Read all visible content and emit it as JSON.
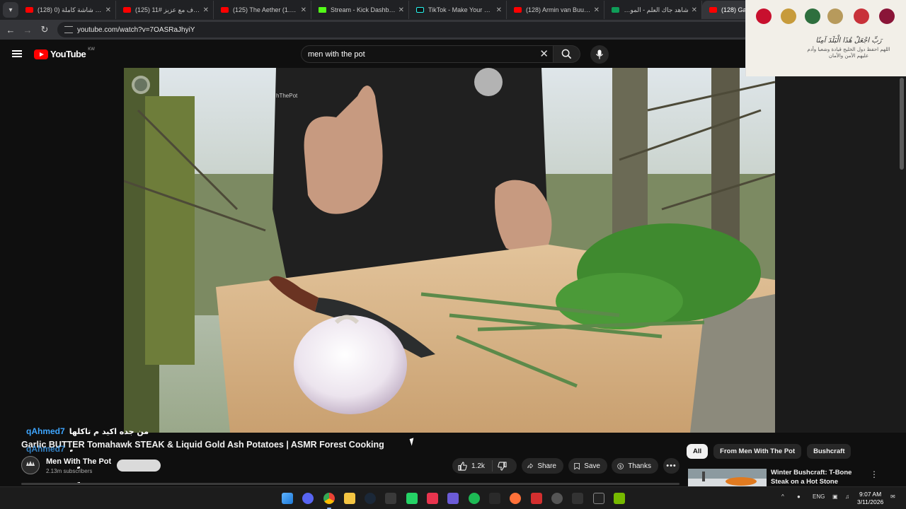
{
  "browser": {
    "tabs": [
      {
        "title": "(128) البث شاشة كاملة (0",
        "favicon": "youtube"
      },
      {
        "title": "(125) حروف مع عزيز #11",
        "favicon": "youtube"
      },
      {
        "title": "(125) The Aether (1.20.1) |",
        "favicon": "youtube"
      },
      {
        "title": "Stream - Kick Dashboard",
        "favicon": "kick"
      },
      {
        "title": "TikTok - Make Your Day",
        "favicon": "tiktok"
      },
      {
        "title": "(128) Armin van Buuren -",
        "favicon": "youtube"
      },
      {
        "title": "شاهد جاك العلم - الموسم",
        "favicon": "sheets"
      },
      {
        "title": "(128) Garli",
        "favicon": "youtube",
        "active": true
      }
    ],
    "url": "youtube.com/watch?v=7OASRaJhyiY"
  },
  "youtube": {
    "logo_text": "YouTube",
    "country_code": "KW",
    "search_query": "men with the pot"
  },
  "overlay": {
    "caption_line1": "رَبِّ اجْعَلْ هَٰذَا الْبَلَدَ آمِنًا",
    "caption_line2": "اللهم احفظ دول الخليج قيادة وشعبا وأدم عليهم الأمن والأمان"
  },
  "chat": {
    "message1": {
      "user": "qAhmed7",
      "text": "من جده اكيد م تاكلها"
    },
    "message2": {
      "user": "qAhmed7",
      "text": "ٍٍٍٍٍٍٍٍٍٍٍٍٍٍٍٍٍٍٍٍٍٍٍٍٍٍٍٍٍٍٍٍٍٍٍٍٍٍٍٍٍ"
    },
    "spam_line2": "ٍٍٍٍٍٍٍٍٍٍٍٍٍٍٍٍٍٍٍٍٍٍٍٍٍٍٍٍٍٍٍٍٍٍٍٍٍٍٍٍ",
    "spam_line3": "ٍٍٍٍٍٍٍٍٍٍٍٍٍٍٍٍٍٍٍٍٍٍٍٍٍٍٍٍٍٍٍٍٍٍٍٍٍٍٍٍ",
    "spam_line4": "ٍٍٍٍٍٍٍٍٍٍٍٍٍٍٍٍٍٍٍٍٍ"
  },
  "video": {
    "title": "Garlic BUTTER Tomahawk STEAK & Liquid Gold Ash Potatoes | ASMR Forest Cooking",
    "channel": "Men With The Pot",
    "subscribers": "2.13m subscribers",
    "likes": "1.2k",
    "share_label": "Share",
    "save_label": "Save",
    "thanks_label": "Thanks",
    "progress": 0.0
  },
  "recommendations": {
    "chips": [
      "All",
      "From Men With The Pot",
      "Bushcraft"
    ],
    "active_chip": "All",
    "first_title": "Winter Bushcraft: T-Bone Steak on a Hot Stone"
  },
  "taskbar": {
    "language": "ENG",
    "time": "9:07 AM",
    "date": "3/11/2026"
  },
  "colors": {
    "youtube_red": "#ff0000",
    "chat_user": "#3ea6ff",
    "background": "#0f0f0f"
  }
}
